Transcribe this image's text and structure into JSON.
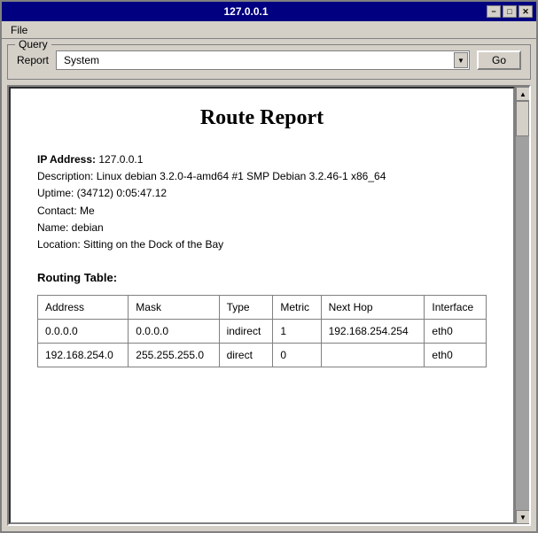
{
  "window": {
    "title": "127.0.0.1",
    "min_btn": "−",
    "max_btn": "□",
    "close_btn": "✕"
  },
  "menu": {
    "file_label": "File"
  },
  "query": {
    "legend": "Query",
    "report_label": "Report",
    "report_value": "System",
    "go_label": "Go",
    "report_options": [
      "System"
    ]
  },
  "report": {
    "title": "Route Report",
    "ip_label": "IP Address:",
    "ip_value": "127.0.0.1",
    "description": "Description: Linux debian 3.2.0-4-amd64 #1 SMP Debian 3.2.46-1 x86_64",
    "uptime": "Uptime: (34712) 0:05:47.12",
    "contact": "Contact: Me",
    "name": "Name: debian",
    "location": "Location: Sitting on the Dock of the Bay",
    "routing_table_title": "Routing Table:",
    "table": {
      "headers": [
        "Address",
        "Mask",
        "Type",
        "Metric",
        "Next Hop",
        "Interface"
      ],
      "rows": [
        {
          "address": "0.0.0.0",
          "mask": "0.0.0.0",
          "type": "indirect",
          "metric": "1",
          "next_hop": "192.168.254.254",
          "interface": "eth0"
        },
        {
          "address": "192.168.254.0",
          "mask": "255.255.255.0",
          "type": "direct",
          "metric": "0",
          "next_hop": "",
          "interface": "eth0"
        }
      ]
    }
  }
}
